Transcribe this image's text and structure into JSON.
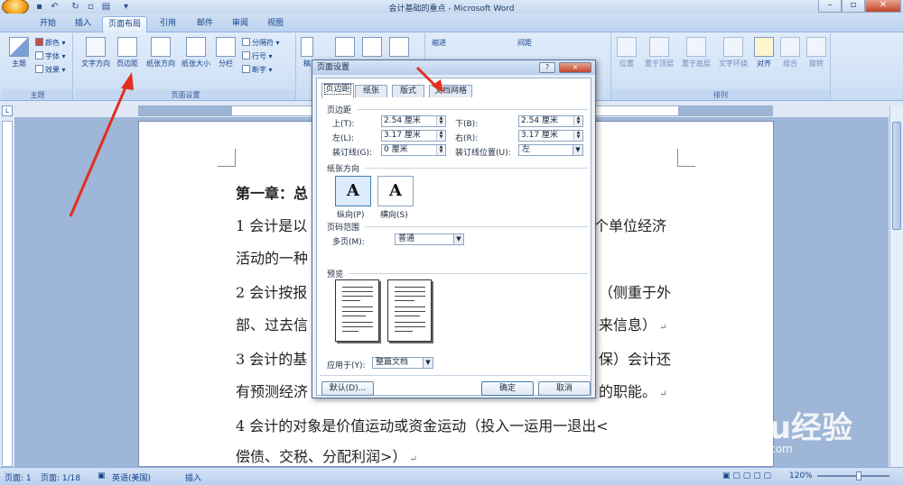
{
  "window": {
    "title": "会计基础的重点 - Microsoft Word"
  },
  "tabs": [
    "开始",
    "插入",
    "页面布局",
    "引用",
    "邮件",
    "审阅",
    "视图"
  ],
  "active_tab": "页面布局",
  "ribbon": {
    "themes_group": {
      "label": "主题",
      "theme_button": "主题",
      "colors": "颜色",
      "fonts": "字体",
      "effects": "效果"
    },
    "page_setup_group": {
      "label": "页面设置",
      "text_direction": "文字方向",
      "margins": "页边距",
      "orientation": "纸张方向",
      "size": "纸张大小",
      "columns": "分栏",
      "breaks": "分隔符",
      "line_numbers": "行号",
      "hyphenation": "断字"
    },
    "bg_group_partial": {
      "label": "稿"
    },
    "indent_label": "缩进",
    "spacing_label": "间距",
    "arrange_group": {
      "label": "排列",
      "position": "位置",
      "bring_front": "置于顶层",
      "send_back": "置于底层",
      "text_wrap": "文字环绕",
      "align": "对齐",
      "group": "组合",
      "rotate": "旋转"
    }
  },
  "document": {
    "lines": [
      "第一章：总",
      "1 会计是以",
      "个单位经济",
      "活动的一种",
      "2 会计按报",
      "（侧重于外",
      "部、过去信",
      "来信息）",
      "3 会计的基",
      "保）会计还",
      "有预测经济",
      "的职能。",
      "4 会计的对象是价值运动或资金运动（投入一运用一退出<",
      "偿债、交税、分配利润>）"
    ]
  },
  "dialog": {
    "title": "页面设置",
    "help": "?",
    "close": "×",
    "tabs": [
      "页边距",
      "纸张",
      "版式",
      "文档网格"
    ],
    "active_tab": "页边距",
    "margins_section": "页边距",
    "top_label": "上(T):",
    "top_value": "2.54 厘米",
    "bottom_label": "下(B):",
    "bottom_value": "2.54 厘米",
    "left_label": "左(L):",
    "left_value": "3.17 厘米",
    "right_label": "右(R):",
    "right_value": "3.17 厘米",
    "gutter_label": "装订线(G):",
    "gutter_value": "0 厘米",
    "gutter_pos_label": "装订线位置(U):",
    "gutter_pos_value": "左",
    "orientation_section": "纸张方向",
    "portrait": "纵向(P)",
    "landscape": "横向(S)",
    "pages_section": "页码范围",
    "multiple_pages_label": "多页(M):",
    "multiple_pages_value": "普通",
    "preview_section": "预览",
    "apply_to_label": "应用于(Y):",
    "apply_to_value": "整篇文档",
    "default_button": "默认(D)...",
    "ok_button": "确定",
    "cancel_button": "取消"
  },
  "status": {
    "page": "页面: 1",
    "pages": "页面: 1/18",
    "language": "英语(美国)",
    "mode": "插入",
    "zoom": "120%"
  },
  "watermark": {
    "brand": "Baidu经验",
    "url": "jingyan.baidu.com"
  },
  "colors": {
    "ribbon_blue": "#15428b",
    "annotation_red": "#e0301e",
    "page_bg": "#ffffff",
    "workspace": "#9eb6d7"
  }
}
